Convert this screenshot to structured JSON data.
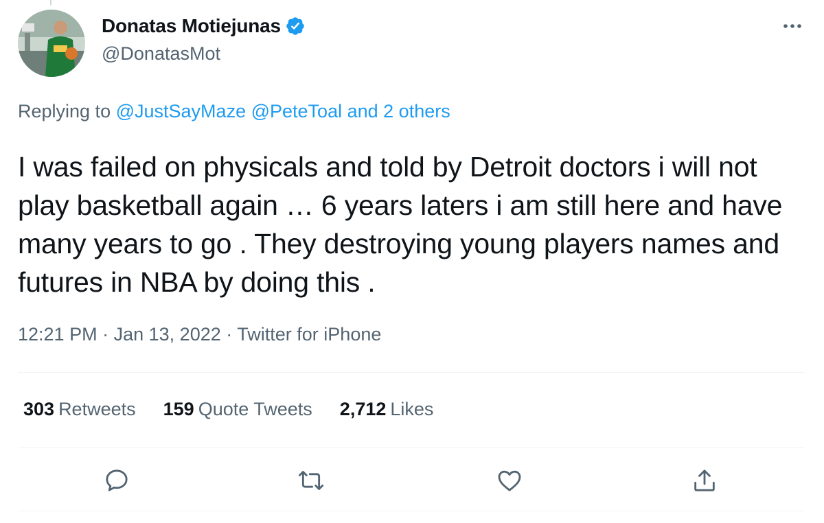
{
  "author": {
    "display_name": "Donatas Motiejunas",
    "handle": "@DonatasMot",
    "verified": true
  },
  "reply_to": {
    "prefix": "Replying to",
    "mentions": [
      "@JustSayMaze",
      "@PeteToal"
    ],
    "others": "and 2 others"
  },
  "tweet": {
    "text": "I was failed on physicals and told by Detroit doctors i will not play basketball again … 6 years laters i am still here and have many years to go . They destroying young players names and futures in NBA by doing this ."
  },
  "meta": {
    "time": "12:21 PM",
    "separator": "·",
    "date": "Jan 13, 2022",
    "source": "Twitter for iPhone"
  },
  "stats": {
    "retweets": {
      "count": "303",
      "label": "Retweets"
    },
    "quotes": {
      "count": "159",
      "label": "Quote Tweets"
    },
    "likes": {
      "count": "2,712",
      "label": "Likes"
    }
  },
  "actions": [
    "reply-icon",
    "retweet-icon",
    "like-icon",
    "share-icon"
  ],
  "colors": {
    "link": "#1d9bf0",
    "secondary_text": "#536471",
    "primary_text": "#0f1419",
    "divider": "#eff3f4",
    "jersey": "#1f7a3a"
  }
}
